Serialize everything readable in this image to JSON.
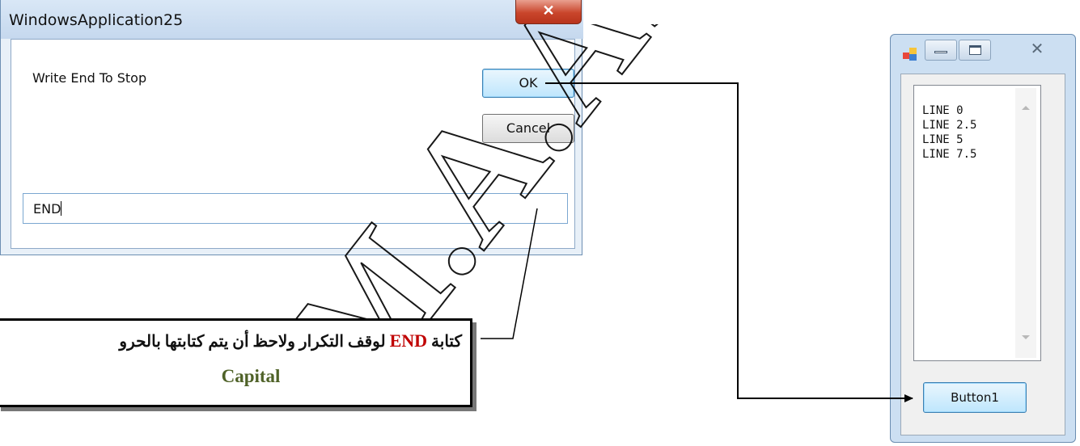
{
  "input_dialog": {
    "title": "WindowsApplication25",
    "close_glyph": "✕",
    "prompt": "Write End To Stop",
    "ok_label": "OK",
    "cancel_label": "Cancel",
    "input_value": "END"
  },
  "form1": {
    "list_items": [
      "LINE 0",
      "LINE 2.5",
      "LINE 5",
      "LINE 7.5"
    ],
    "button_label": "Button1",
    "close_glyph": "✕"
  },
  "callout": {
    "line1_prefix": "كتابة",
    "line1_keyword": "END",
    "line1_suffix": "لوقف التكرار ولاحظ أن يتم كتابتها بالحرو",
    "line2": "Capital"
  },
  "watermark": {
    "text": "M.A.Abu",
    "color": "#000000"
  },
  "colors": {
    "keyword": "#c00000",
    "capital": "#4f6228"
  }
}
